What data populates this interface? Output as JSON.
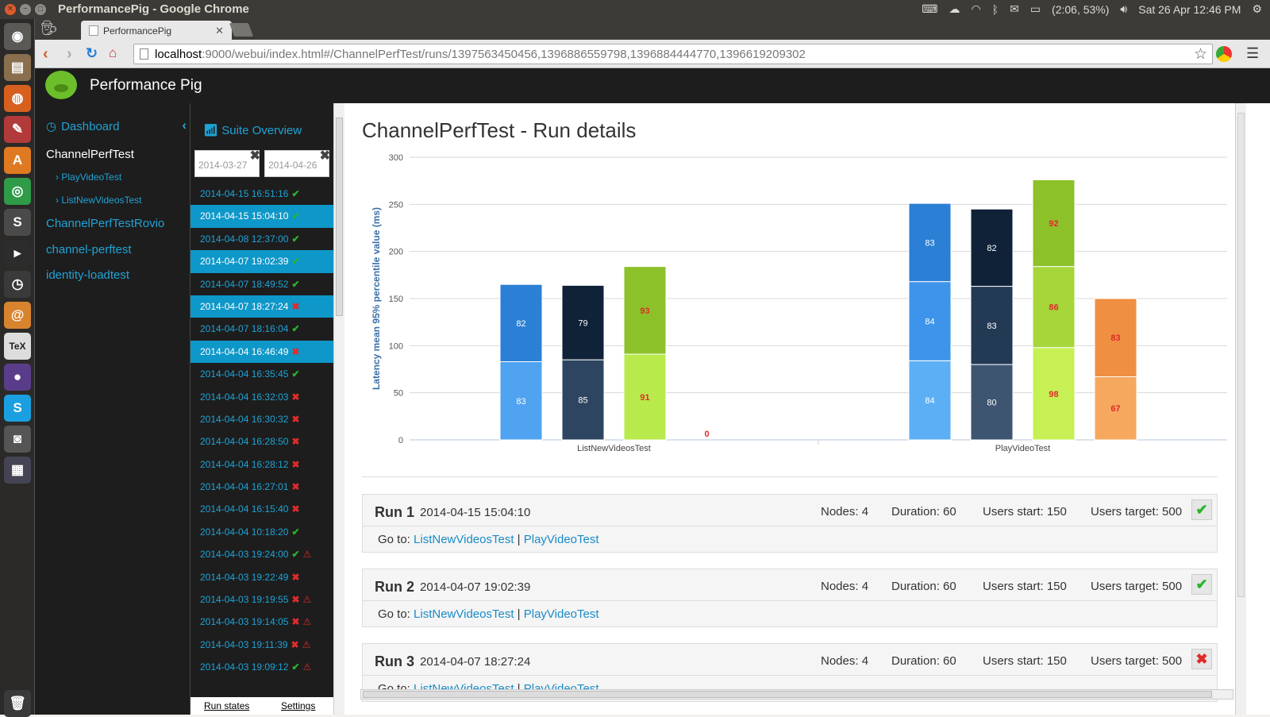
{
  "window_title": "PerformancePig - Google Chrome",
  "tray": {
    "battery": "(2:06, 53%)",
    "clock": "Sat 26 Apr 12:46 PM"
  },
  "browser": {
    "tab_title": "PerformancePig",
    "url_host": "localhost",
    "url_rest": ":9000/webui/index.html#/ChannelPerfTest/runs/1397563450456,1396886559798,1396884444770,1396619209302"
  },
  "app": {
    "name": "Performance Pig"
  },
  "sidebar": {
    "dashboard": "Dashboard",
    "items": [
      {
        "label": "ChannelPerfTest"
      },
      {
        "label": "PlayVideoTest"
      },
      {
        "label": "ListNewVideosTest"
      },
      {
        "label": "ChannelPerfTestRovio"
      },
      {
        "label": "channel-perftest"
      },
      {
        "label": "identity-loadtest"
      }
    ]
  },
  "runs_panel": {
    "suite_overview": "Suite Overview",
    "date_from": "2014-03-27",
    "date_to": "2014-04-26",
    "footer_states": "Run states",
    "footer_settings": "Settings",
    "runs": [
      {
        "ts": "2014-04-15 16:51:16",
        "status": "ok",
        "hl": false,
        "warn": false
      },
      {
        "ts": "2014-04-15 15:04:10",
        "status": "ok",
        "hl": true,
        "warn": false
      },
      {
        "ts": "2014-04-08 12:37:00",
        "status": "ok",
        "hl": false,
        "warn": false
      },
      {
        "ts": "2014-04-07 19:02:39",
        "status": "ok",
        "hl": true,
        "warn": false
      },
      {
        "ts": "2014-04-07 18:49:52",
        "status": "ok",
        "hl": false,
        "warn": false
      },
      {
        "ts": "2014-04-07 18:27:24",
        "status": "fail",
        "hl": true,
        "warn": false
      },
      {
        "ts": "2014-04-07 18:16:04",
        "status": "ok",
        "hl": false,
        "warn": false
      },
      {
        "ts": "2014-04-04 16:46:49",
        "status": "fail",
        "hl": true,
        "warn": false
      },
      {
        "ts": "2014-04-04 16:35:45",
        "status": "ok",
        "hl": false,
        "warn": false
      },
      {
        "ts": "2014-04-04 16:32:03",
        "status": "fail",
        "hl": false,
        "warn": false
      },
      {
        "ts": "2014-04-04 16:30:32",
        "status": "fail",
        "hl": false,
        "warn": false
      },
      {
        "ts": "2014-04-04 16:28:50",
        "status": "fail",
        "hl": false,
        "warn": false
      },
      {
        "ts": "2014-04-04 16:28:12",
        "status": "fail",
        "hl": false,
        "warn": false
      },
      {
        "ts": "2014-04-04 16:27:01",
        "status": "fail",
        "hl": false,
        "warn": false
      },
      {
        "ts": "2014-04-04 16:15:40",
        "status": "fail",
        "hl": false,
        "warn": false
      },
      {
        "ts": "2014-04-04 10:18:20",
        "status": "ok",
        "hl": false,
        "warn": false
      },
      {
        "ts": "2014-04-03 19:24:00",
        "status": "ok",
        "hl": false,
        "warn": true
      },
      {
        "ts": "2014-04-03 19:22:49",
        "status": "fail",
        "hl": false,
        "warn": false
      },
      {
        "ts": "2014-04-03 19:19:55",
        "status": "fail",
        "hl": false,
        "warn": true
      },
      {
        "ts": "2014-04-03 19:14:05",
        "status": "fail",
        "hl": false,
        "warn": true
      },
      {
        "ts": "2014-04-03 19:11:39",
        "status": "fail",
        "hl": false,
        "warn": true
      },
      {
        "ts": "2014-04-03 19:09:12",
        "status": "ok",
        "hl": false,
        "warn": true
      }
    ]
  },
  "page_title": "ChannelPerfTest - Run details",
  "chart_data": {
    "type": "bar",
    "stacked": true,
    "ylabel": "Latency mean 95% percentile value (ms)",
    "ylim": [
      0,
      300
    ],
    "yticks": [
      0,
      50,
      100,
      150,
      200,
      250,
      300
    ],
    "grid": true,
    "categories": [
      "ListNewVideosTest",
      "PlayVideoTest"
    ],
    "groups": [
      {
        "category": "ListNewVideosTest",
        "bars": [
          {
            "segments": [
              83,
              82
            ],
            "colors": [
              "#4fa3f0",
              "#2b7fd4"
            ]
          },
          {
            "segments": [
              85,
              79
            ],
            "colors": [
              "#2d4560",
              "#0f2238"
            ]
          },
          {
            "segments": [
              91,
              93
            ],
            "colors": [
              "#b9ea4c",
              "#8dc12a"
            ],
            "label_color": "#e02b2b"
          },
          {
            "segments": [
              0
            ],
            "colors": [
              "#ef8f42"
            ],
            "label_color": "#e02b2b"
          }
        ]
      },
      {
        "category": "PlayVideoTest",
        "bars": [
          {
            "segments": [
              84,
              84,
              83
            ],
            "colors": [
              "#5daff5",
              "#3d94ea",
              "#2b7fd4"
            ]
          },
          {
            "segments": [
              80,
              83,
              82
            ],
            "colors": [
              "#3d5571",
              "#233a55",
              "#0f2238"
            ]
          },
          {
            "segments": [
              98,
              86,
              92
            ],
            "colors": [
              "#c6f053",
              "#a6d63a",
              "#8dc12a"
            ],
            "label_color": "#e02b2b"
          },
          {
            "segments": [
              67,
              83
            ],
            "colors": [
              "#f5a85e",
              "#ef8f42"
            ],
            "label_color": "#e02b2b"
          }
        ]
      }
    ]
  },
  "run_cards": [
    {
      "name": "Run 1",
      "date": "2014-04-15 15:04:10",
      "nodes": "Nodes: 4",
      "duration": "Duration: 60",
      "users_start": "Users start: 150",
      "users_target": "Users target: 500",
      "status": "ok",
      "goto_label": "Go to:",
      "link1": "ListNewVideosTest",
      "sep": "|",
      "link2": "PlayVideoTest"
    },
    {
      "name": "Run 2",
      "date": "2014-04-07 19:02:39",
      "nodes": "Nodes: 4",
      "duration": "Duration: 60",
      "users_start": "Users start: 150",
      "users_target": "Users target: 500",
      "status": "ok",
      "goto_label": "Go to:",
      "link1": "ListNewVideosTest",
      "sep": "|",
      "link2": "PlayVideoTest"
    },
    {
      "name": "Run 3",
      "date": "2014-04-07 18:27:24",
      "nodes": "Nodes: 4",
      "duration": "Duration: 60",
      "users_start": "Users start: 150",
      "users_target": "Users target: 500",
      "status": "fail",
      "goto_label": "Go to:",
      "link1": "ListNewVideosTest",
      "sep": "|",
      "link2": "PlayVideoTest"
    }
  ],
  "colors": {
    "accent": "#1fa3d6",
    "highlight": "#0e97c9",
    "ok": "#29b429",
    "fail": "#e02b2b"
  }
}
